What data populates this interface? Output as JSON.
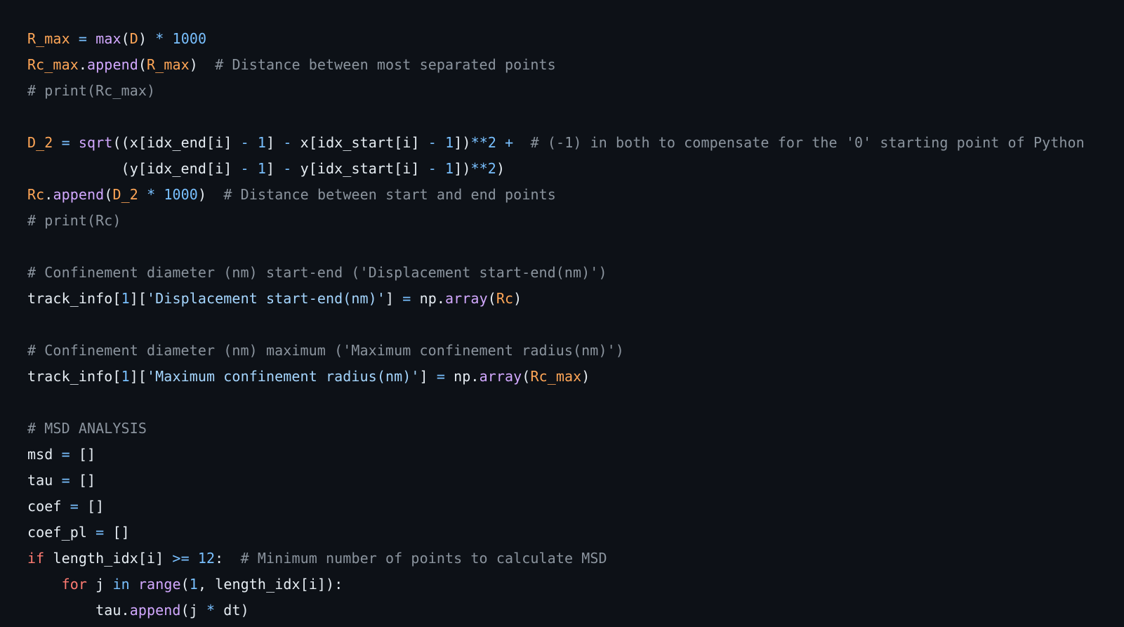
{
  "theme": {
    "background": "#0d1117",
    "colors": {
      "default": "#e6edf3",
      "variable": "#ffa657",
      "function": "#d2a8ff",
      "operator": "#79c0ff",
      "number": "#79c0ff",
      "comment": "#8b949e",
      "string": "#a5d6ff",
      "keyword": "#ff7b72"
    }
  },
  "code": {
    "language": "python",
    "lines": [
      [
        {
          "t": "R_max",
          "c": "variable"
        },
        {
          "t": " ",
          "c": "default"
        },
        {
          "t": "=",
          "c": "operator"
        },
        {
          "t": " ",
          "c": "default"
        },
        {
          "t": "max",
          "c": "function"
        },
        {
          "t": "(",
          "c": "default"
        },
        {
          "t": "D",
          "c": "variable"
        },
        {
          "t": ") ",
          "c": "default"
        },
        {
          "t": "*",
          "c": "operator"
        },
        {
          "t": " ",
          "c": "default"
        },
        {
          "t": "1000",
          "c": "number"
        }
      ],
      [
        {
          "t": "Rc_max",
          "c": "variable"
        },
        {
          "t": ".",
          "c": "default"
        },
        {
          "t": "append",
          "c": "function"
        },
        {
          "t": "(",
          "c": "default"
        },
        {
          "t": "R_max",
          "c": "variable"
        },
        {
          "t": ")  ",
          "c": "default"
        },
        {
          "t": "# Distance between most separated points",
          "c": "comment"
        }
      ],
      [
        {
          "t": "# print(Rc_max)",
          "c": "comment"
        }
      ],
      [],
      [
        {
          "t": "D_2",
          "c": "variable"
        },
        {
          "t": " ",
          "c": "default"
        },
        {
          "t": "=",
          "c": "operator"
        },
        {
          "t": " ",
          "c": "default"
        },
        {
          "t": "sqrt",
          "c": "function"
        },
        {
          "t": "((x[idx_end[i] ",
          "c": "default"
        },
        {
          "t": "-",
          "c": "operator"
        },
        {
          "t": " ",
          "c": "default"
        },
        {
          "t": "1",
          "c": "number"
        },
        {
          "t": "] ",
          "c": "default"
        },
        {
          "t": "-",
          "c": "operator"
        },
        {
          "t": " x[idx_start[i] ",
          "c": "default"
        },
        {
          "t": "-",
          "c": "operator"
        },
        {
          "t": " ",
          "c": "default"
        },
        {
          "t": "1",
          "c": "number"
        },
        {
          "t": "])",
          "c": "default"
        },
        {
          "t": "**",
          "c": "operator"
        },
        {
          "t": "2",
          "c": "number"
        },
        {
          "t": " ",
          "c": "default"
        },
        {
          "t": "+",
          "c": "operator"
        },
        {
          "t": "  ",
          "c": "default"
        },
        {
          "t": "# (-1) in both to compensate for the '0' starting point of Python",
          "c": "comment"
        }
      ],
      [
        {
          "t": "           (y[idx_end[i] ",
          "c": "default"
        },
        {
          "t": "-",
          "c": "operator"
        },
        {
          "t": " ",
          "c": "default"
        },
        {
          "t": "1",
          "c": "number"
        },
        {
          "t": "] ",
          "c": "default"
        },
        {
          "t": "-",
          "c": "operator"
        },
        {
          "t": " y[idx_start[i] ",
          "c": "default"
        },
        {
          "t": "-",
          "c": "operator"
        },
        {
          "t": " ",
          "c": "default"
        },
        {
          "t": "1",
          "c": "number"
        },
        {
          "t": "])",
          "c": "default"
        },
        {
          "t": "**",
          "c": "operator"
        },
        {
          "t": "2",
          "c": "number"
        },
        {
          "t": ")",
          "c": "default"
        }
      ],
      [
        {
          "t": "Rc",
          "c": "variable"
        },
        {
          "t": ".",
          "c": "default"
        },
        {
          "t": "append",
          "c": "function"
        },
        {
          "t": "(",
          "c": "default"
        },
        {
          "t": "D_2",
          "c": "variable"
        },
        {
          "t": " ",
          "c": "default"
        },
        {
          "t": "*",
          "c": "operator"
        },
        {
          "t": " ",
          "c": "default"
        },
        {
          "t": "1000",
          "c": "number"
        },
        {
          "t": ")  ",
          "c": "default"
        },
        {
          "t": "# Distance between start and end points",
          "c": "comment"
        }
      ],
      [
        {
          "t": "# print(Rc)",
          "c": "comment"
        }
      ],
      [],
      [
        {
          "t": "# Confinement diameter (nm) start-end ('Displacement start-end(nm)')",
          "c": "comment"
        }
      ],
      [
        {
          "t": "track_info[",
          "c": "default"
        },
        {
          "t": "1",
          "c": "number"
        },
        {
          "t": "][",
          "c": "default"
        },
        {
          "t": "'Displacement start-end(nm)'",
          "c": "string"
        },
        {
          "t": "] ",
          "c": "default"
        },
        {
          "t": "=",
          "c": "operator"
        },
        {
          "t": " np.",
          "c": "default"
        },
        {
          "t": "array",
          "c": "function"
        },
        {
          "t": "(",
          "c": "default"
        },
        {
          "t": "Rc",
          "c": "variable"
        },
        {
          "t": ")",
          "c": "default"
        }
      ],
      [],
      [
        {
          "t": "# Confinement diameter (nm) maximum ('Maximum confinement radius(nm)')",
          "c": "comment"
        }
      ],
      [
        {
          "t": "track_info[",
          "c": "default"
        },
        {
          "t": "1",
          "c": "number"
        },
        {
          "t": "][",
          "c": "default"
        },
        {
          "t": "'Maximum confinement radius(nm)'",
          "c": "string"
        },
        {
          "t": "] ",
          "c": "default"
        },
        {
          "t": "=",
          "c": "operator"
        },
        {
          "t": " np.",
          "c": "default"
        },
        {
          "t": "array",
          "c": "function"
        },
        {
          "t": "(",
          "c": "default"
        },
        {
          "t": "Rc_max",
          "c": "variable"
        },
        {
          "t": ")",
          "c": "default"
        }
      ],
      [],
      [
        {
          "t": "# MSD ANALYSIS",
          "c": "comment"
        }
      ],
      [
        {
          "t": "msd ",
          "c": "default"
        },
        {
          "t": "=",
          "c": "operator"
        },
        {
          "t": " []",
          "c": "default"
        }
      ],
      [
        {
          "t": "tau ",
          "c": "default"
        },
        {
          "t": "=",
          "c": "operator"
        },
        {
          "t": " []",
          "c": "default"
        }
      ],
      [
        {
          "t": "coef ",
          "c": "default"
        },
        {
          "t": "=",
          "c": "operator"
        },
        {
          "t": " []",
          "c": "default"
        }
      ],
      [
        {
          "t": "coef_pl ",
          "c": "default"
        },
        {
          "t": "=",
          "c": "operator"
        },
        {
          "t": " []",
          "c": "default"
        }
      ],
      [
        {
          "t": "if",
          "c": "keyword"
        },
        {
          "t": " length_idx[i] ",
          "c": "default"
        },
        {
          "t": ">=",
          "c": "operator"
        },
        {
          "t": " ",
          "c": "default"
        },
        {
          "t": "12",
          "c": "number"
        },
        {
          "t": ":  ",
          "c": "default"
        },
        {
          "t": "# Minimum number of points to calculate MSD",
          "c": "comment"
        }
      ],
      [
        {
          "t": "    ",
          "c": "default"
        },
        {
          "t": "for",
          "c": "keyword"
        },
        {
          "t": " j ",
          "c": "default"
        },
        {
          "t": "in",
          "c": "operator"
        },
        {
          "t": " ",
          "c": "default"
        },
        {
          "t": "range",
          "c": "function"
        },
        {
          "t": "(",
          "c": "default"
        },
        {
          "t": "1",
          "c": "number"
        },
        {
          "t": ", length_idx[i]):",
          "c": "default"
        }
      ],
      [
        {
          "t": "        tau.",
          "c": "default"
        },
        {
          "t": "append",
          "c": "function"
        },
        {
          "t": "(j ",
          "c": "default"
        },
        {
          "t": "*",
          "c": "operator"
        },
        {
          "t": " dt)",
          "c": "default"
        }
      ]
    ]
  }
}
